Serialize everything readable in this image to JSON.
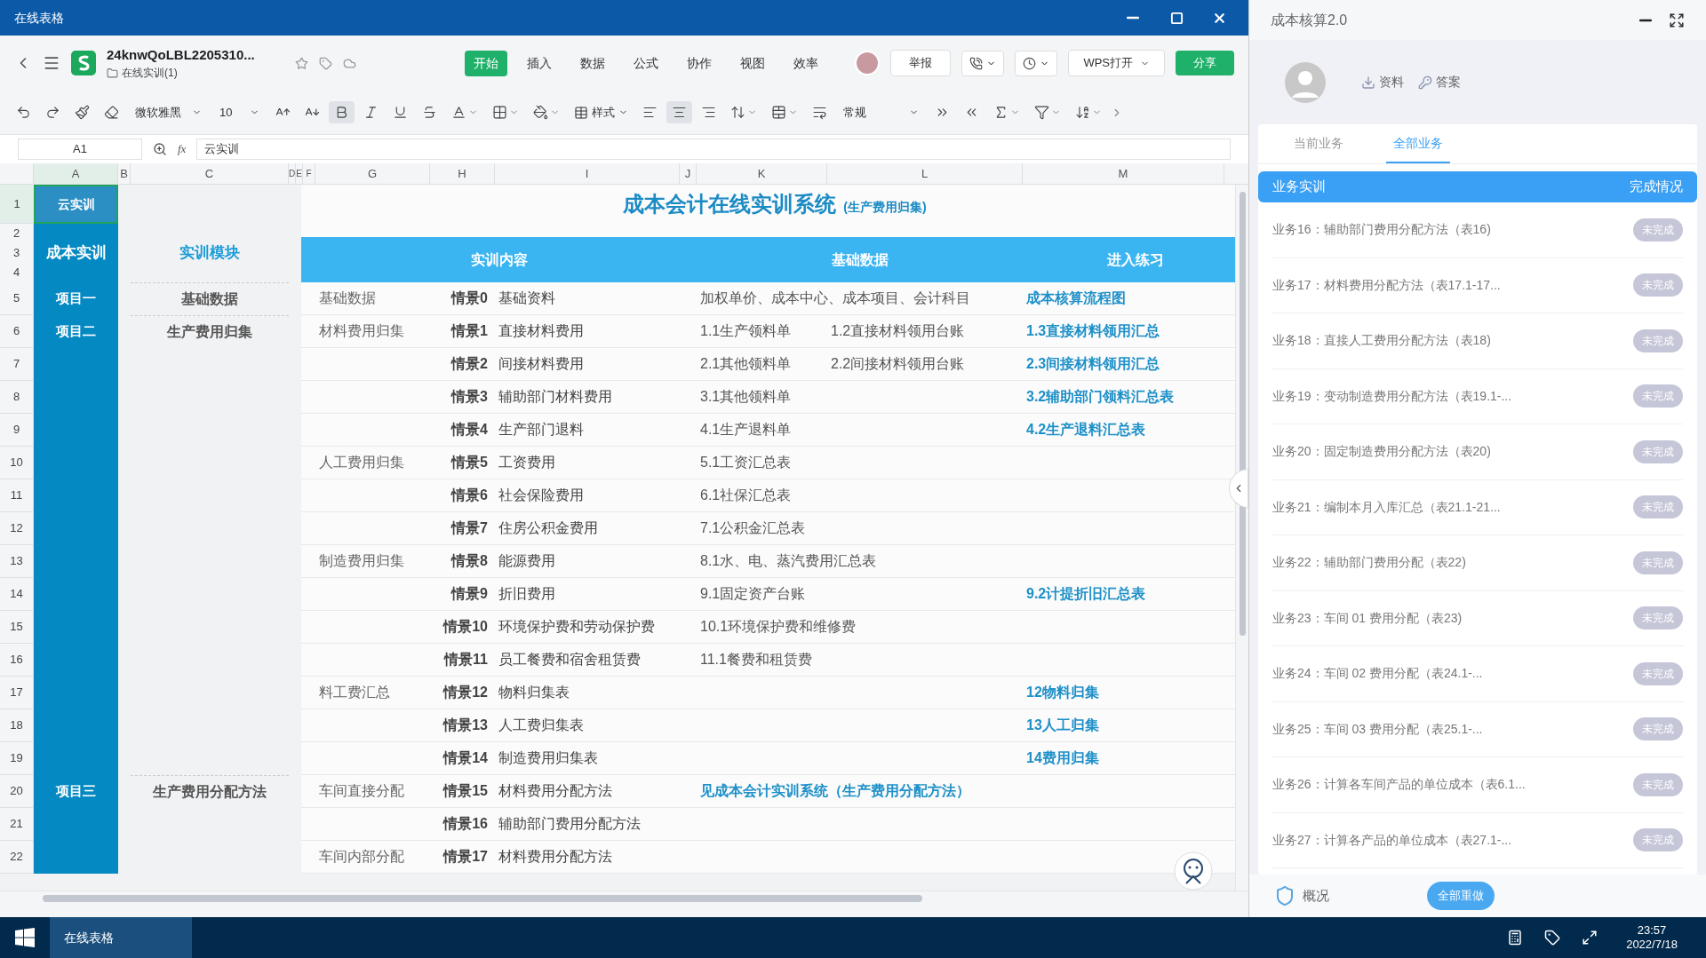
{
  "window": {
    "title": "在线表格"
  },
  "document": {
    "name": "24knwQoLBL2205310...",
    "folder": "在线实训(1)"
  },
  "menu_tabs": [
    {
      "label": "开始",
      "selected": true
    },
    {
      "label": "插入",
      "selected": false
    },
    {
      "label": "数据",
      "selected": false
    },
    {
      "label": "公式",
      "selected": false
    },
    {
      "label": "协作",
      "selected": false
    },
    {
      "label": "视图",
      "selected": false
    },
    {
      "label": "效率",
      "selected": false
    }
  ],
  "header_buttons": {
    "report": "举报",
    "open": "WPS打开",
    "share": "分享"
  },
  "toolbar": {
    "font": "微软雅黑",
    "size": "10",
    "style": "样式",
    "number_format": "常规",
    "bold": true,
    "italic": false,
    "underline": false,
    "strike": false,
    "align_left": false,
    "align_center": true,
    "align_right": false
  },
  "formula_bar": {
    "cell": "A1",
    "fx": "fx",
    "value": "云实训"
  },
  "columns": [
    "A",
    "B",
    "C",
    "D",
    "E",
    "F",
    "G",
    "H",
    "I",
    "J",
    "K",
    "L",
    "M"
  ],
  "top": {
    "row1": "1",
    "header_rows": [
      "2",
      "3",
      "4"
    ],
    "a1": "云实训",
    "a1_selected": true,
    "a_header": "成本实训",
    "c_header": "实训模块",
    "title": "成本会计在线实训系统",
    "subtitle": "(生产费用归集)",
    "band": [
      "实训内容",
      "基础数据",
      "进入练习"
    ]
  },
  "rows": [
    {
      "num": "5",
      "a": "项目一",
      "c": "基础数据",
      "category": "基础数据",
      "scene": "情景0",
      "content": "基础资料",
      "data": [
        {
          "text": "加权单价、成本中心、成本项目、会计科目",
          "kind": "plain"
        }
      ],
      "practice": "成本核算流程图"
    },
    {
      "num": "6",
      "a": "项目二",
      "c": "生产费用归集",
      "category": "材料费用归集",
      "scene": "情景1",
      "content": "直接材料费用",
      "data": [
        {
          "text": "1.1生产领料单",
          "kind": "plain"
        },
        {
          "text": "1.2直接材料领用台账",
          "kind": "plain"
        }
      ],
      "practice": "1.3直接材料领用汇总"
    },
    {
      "num": "7",
      "scene": "情景2",
      "content": "间接材料费用",
      "data": [
        {
          "text": "2.1其他领料单",
          "kind": "plain"
        },
        {
          "text": "2.2间接材料领用台账",
          "kind": "plain"
        }
      ],
      "practice": "2.3间接材料领用汇总"
    },
    {
      "num": "8",
      "scene": "情景3",
      "content": "辅助部门材料费用",
      "data": [
        {
          "text": "3.1其他领料单",
          "kind": "plain"
        }
      ],
      "practice": "3.2辅助部门领料汇总表"
    },
    {
      "num": "9",
      "scene": "情景4",
      "content": "生产部门退料",
      "data": [
        {
          "text": "4.1生产退料单",
          "kind": "plain"
        }
      ],
      "practice": "4.2生产退料汇总表"
    },
    {
      "num": "10",
      "category": "人工费用归集",
      "scene": "情景5",
      "content": "工资费用",
      "data": [
        {
          "text": "5.1工资汇总表",
          "kind": "plain"
        }
      ]
    },
    {
      "num": "11",
      "scene": "情景6",
      "content": "社会保险费用",
      "data": [
        {
          "text": "6.1社保汇总表",
          "kind": "plain"
        }
      ]
    },
    {
      "num": "12",
      "scene": "情景7",
      "content": "住房公积金费用",
      "data": [
        {
          "text": "7.1公积金汇总表",
          "kind": "plain"
        }
      ]
    },
    {
      "num": "13",
      "category": "制造费用归集",
      "scene": "情景8",
      "content": "能源费用",
      "data": [
        {
          "text": "8.1水、电、蒸汽费用汇总表",
          "kind": "plain"
        }
      ]
    },
    {
      "num": "14",
      "scene": "情景9",
      "content": "折旧费用",
      "data": [
        {
          "text": "9.1固定资产台账",
          "kind": "plain"
        }
      ],
      "practice": "9.2计提折旧汇总表"
    },
    {
      "num": "15",
      "scene": "情景10",
      "content": "环境保护费和劳动保护费",
      "data": [
        {
          "text": "10.1环境保护费和维修费",
          "kind": "plain"
        }
      ]
    },
    {
      "num": "16",
      "scene": "情景11",
      "content": "员工餐费和宿舍租赁费",
      "data": [
        {
          "text": "11.1餐费和租赁费",
          "kind": "plain"
        }
      ]
    },
    {
      "num": "17",
      "category": "料工费汇总",
      "scene": "情景12",
      "content": "物料归集表",
      "practice": "12物料归集"
    },
    {
      "num": "18",
      "scene": "情景13",
      "content": "人工费归集表",
      "practice": "13人工归集"
    },
    {
      "num": "19",
      "scene": "情景14",
      "content": "制造费用归集表",
      "practice": "14费用归集"
    },
    {
      "num": "20",
      "a": "项目三",
      "c": "生产费用分配方法",
      "category": "车间直接分配",
      "scene": "情景15",
      "content": "材料费用分配方法",
      "data": [
        {
          "text": "见成本会计实训系统（生产费用分配方法）",
          "kind": "link"
        }
      ]
    },
    {
      "num": "21",
      "scene": "情景16",
      "content": "辅助部门费用分配方法"
    },
    {
      "num": "22",
      "category": "车间内部分配",
      "scene": "情景17",
      "content": "材料费用分配方法"
    }
  ],
  "panel": {
    "title": "成本核算2.0",
    "links": [
      "资料",
      "答案"
    ],
    "tabs": [
      {
        "label": "当前业务",
        "selected": false
      },
      {
        "label": "全部业务",
        "selected": true
      }
    ],
    "list_header": [
      "业务实训",
      "完成情况"
    ],
    "items": [
      {
        "text": "业务16：辅助部门费用分配方法（表16)",
        "status": "未完成",
        "completed": false
      },
      {
        "text": "业务17：材料费用分配方法（表17.1-17...",
        "status": "未完成",
        "completed": false
      },
      {
        "text": "业务18：直接人工费用分配方法（表18)",
        "status": "未完成",
        "completed": false
      },
      {
        "text": "业务19：变动制造费用分配方法（表19.1-...",
        "status": "未完成",
        "completed": false
      },
      {
        "text": "业务20：固定制造费用分配方法（表20)",
        "status": "未完成",
        "completed": false
      },
      {
        "text": "业务21：编制本月入库汇总（表21.1-21...",
        "status": "未完成",
        "completed": false
      },
      {
        "text": "业务22：辅助部门费用分配（表22)",
        "status": "未完成",
        "completed": false
      },
      {
        "text": "业务23：车间 01 费用分配（表23)",
        "status": "未完成",
        "completed": false
      },
      {
        "text": "业务24：车间 02 费用分配（表24.1-...",
        "status": "未完成",
        "completed": false
      },
      {
        "text": "业务25：车间 03 费用分配（表25.1-...",
        "status": "未完成",
        "completed": false
      },
      {
        "text": "业务26：计算各车间产品的单位成本（表6.1...",
        "status": "未完成",
        "completed": false
      },
      {
        "text": "业务27：计算各产品的单位成本（表27.1-...",
        "status": "未完成",
        "completed": false
      }
    ],
    "overview": "概况",
    "redo_button": "全部重做"
  },
  "taskbar": {
    "app": "在线表格",
    "time": "23:57",
    "date": "2022/7/18"
  }
}
